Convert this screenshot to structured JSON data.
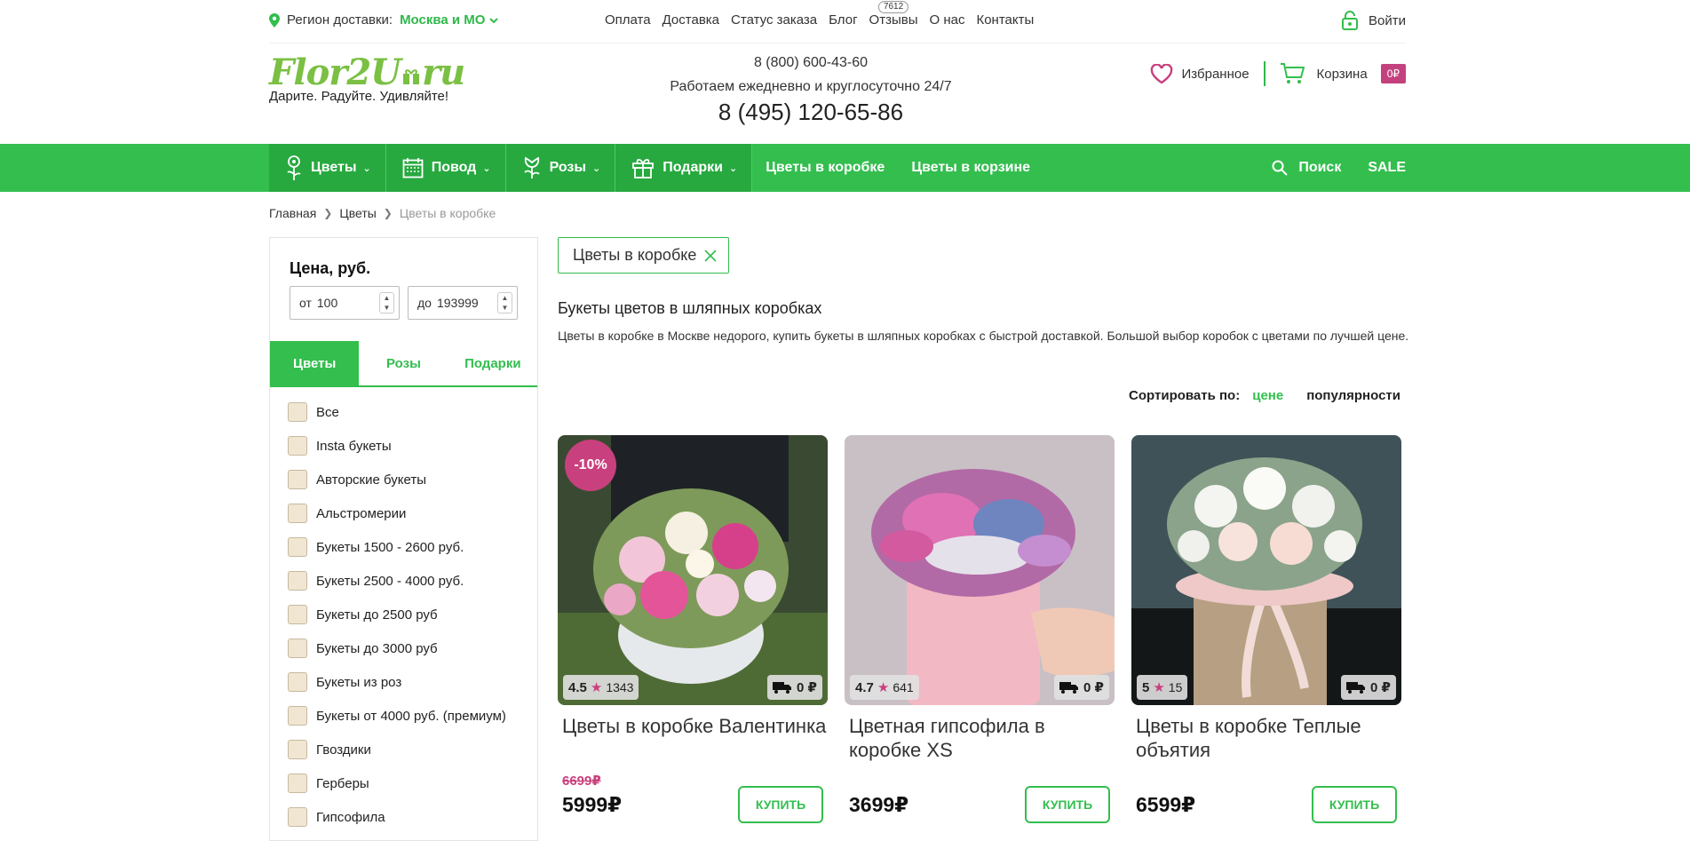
{
  "topbar": {
    "region_label": "Регион доставки:",
    "region_value": "Москва и МО",
    "nav": [
      {
        "label": "Оплата"
      },
      {
        "label": "Доставка"
      },
      {
        "label": "Статус заказа"
      },
      {
        "label": "Блог"
      },
      {
        "label": "Отзывы",
        "badge": "7612"
      },
      {
        "label": "О нас"
      },
      {
        "label": "Контакты"
      }
    ],
    "login": "Войти"
  },
  "header": {
    "logo_part1": "Flor2U",
    "logo_part2": "ru",
    "slogan": "Дарите. Радуйте. Удивляйте!",
    "phone1": "8 (800) 600-43-60",
    "hours": "Работаем ежедневно и круглосуточно 24/7",
    "phone2": "8 (495) 120-65-86",
    "favorites": "Избранное",
    "cart": "Корзина",
    "cart_sum": "0₽"
  },
  "navbar": {
    "dropdowns": [
      {
        "label": "Цветы",
        "icon": "flower-icon"
      },
      {
        "label": "Повод",
        "icon": "calendar-icon"
      },
      {
        "label": "Розы",
        "icon": "rose-icon"
      },
      {
        "label": "Подарки",
        "icon": "gift-icon"
      }
    ],
    "links": [
      "Цветы в коробке",
      "Цветы в корзине"
    ],
    "search": "Поиск",
    "sale": "SALE"
  },
  "breadcrumb": [
    "Главная",
    "Цветы",
    "Цветы в коробке"
  ],
  "filters": {
    "price_title": "Цена, руб.",
    "from_prefix": "от",
    "from_value": "100",
    "to_prefix": "до",
    "to_value": "193999",
    "tabs": [
      "Цветы",
      "Розы",
      "Подарки"
    ],
    "categories": [
      "Все",
      "Insta букеты",
      "Авторские букеты",
      "Альстромерии",
      "Букеты 1500 - 2600 руб.",
      "Букеты 2500 - 4000 руб.",
      "Букеты до 2500 руб",
      "Букеты до 3000 руб",
      "Букеты из роз",
      "Букеты от 4000 руб. (премиум)",
      "Гвоздики",
      "Герберы",
      "Гипсофила"
    ]
  },
  "main": {
    "active_filter": "Цветы в коробке",
    "title": "Букеты цветов в шляпных коробках",
    "description": "Цветы в коробке в Москве недорого, купить букеты в шляпных коробках с быстрой доставкой. Большой выбор коробок с цветами по лучшей цене.",
    "sort_label": "Сортировать по:",
    "sort_price": "цене",
    "sort_popularity": "популярности"
  },
  "products": [
    {
      "name": "Цветы в коробке Валентинка",
      "rating": "4.5",
      "reviews": "1343",
      "delivery": "0 ₽",
      "discount": "-10%",
      "old_price": "6699₽",
      "price": "5999₽",
      "buy": "КУПИТЬ"
    },
    {
      "name": "Цветная гипсофила в коробке XS",
      "rating": "4.7",
      "reviews": "641",
      "delivery": "0 ₽",
      "discount": "",
      "old_price": "",
      "price": "3699₽",
      "buy": "КУПИТЬ"
    },
    {
      "name": "Цветы в коробке Теплые объятия",
      "rating": "5",
      "reviews": "15",
      "delivery": "0 ₽",
      "discount": "",
      "old_price": "",
      "price": "6599₽",
      "buy": "КУПИТЬ"
    }
  ],
  "colors": {
    "brand_green": "#33be4e",
    "accent_pink": "#c9407e"
  }
}
